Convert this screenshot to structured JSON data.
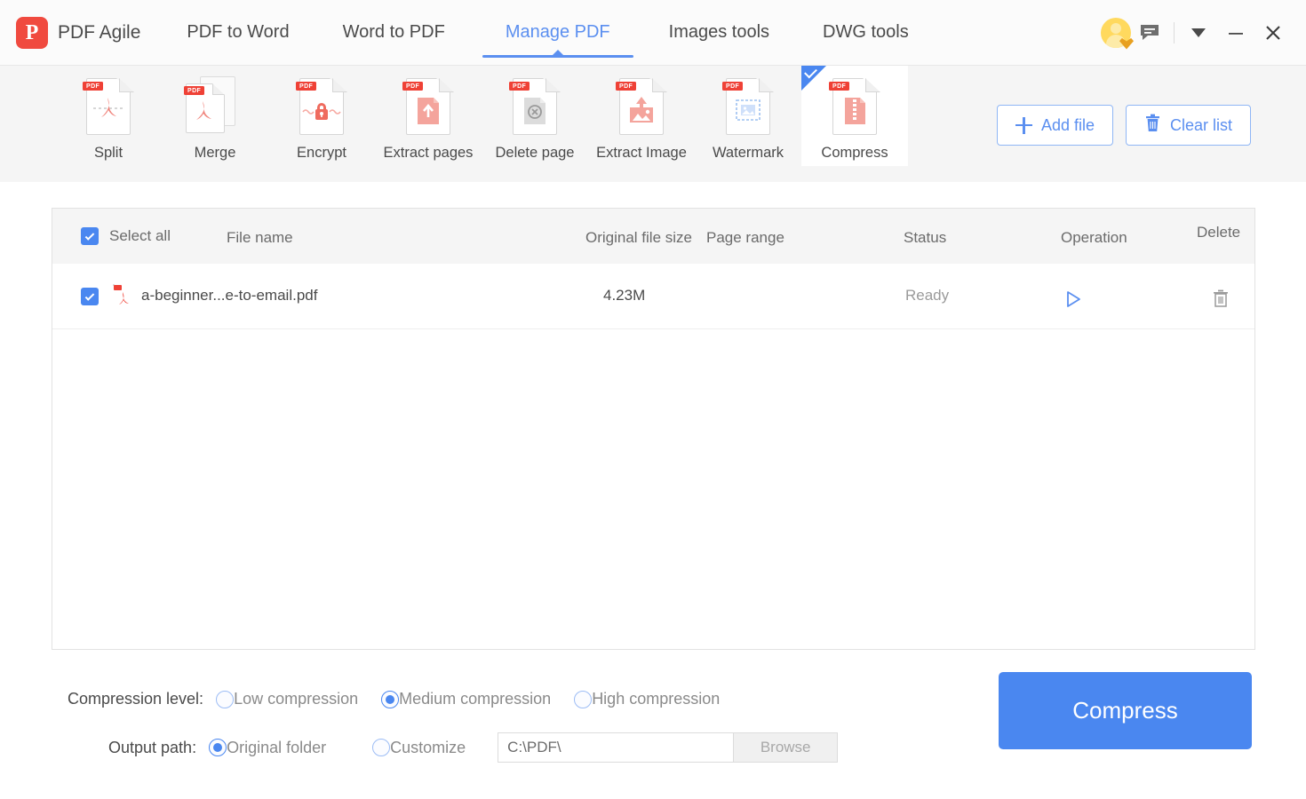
{
  "app": {
    "brand_letter": "P",
    "brand_name": "PDF Agile",
    "brand_color": "#f04a3f",
    "accent_color": "#4a87f0"
  },
  "nav": {
    "items": [
      {
        "label": "PDF to Word",
        "active": false
      },
      {
        "label": "Word to PDF",
        "active": false
      },
      {
        "label": "Manage PDF",
        "active": true
      },
      {
        "label": "Images tools",
        "active": false
      },
      {
        "label": "DWG tools",
        "active": false
      }
    ]
  },
  "window_controls": {
    "avatar": "user-avatar-vip",
    "feedback": "message-icon",
    "dropdown": "chevron-down-icon",
    "minimize": "minimize-icon",
    "close": "close-icon"
  },
  "toolbar": {
    "tools": [
      {
        "label": "Split",
        "icon": "pdf-split-icon",
        "selected": false
      },
      {
        "label": "Merge",
        "icon": "pdf-merge-icon",
        "selected": false
      },
      {
        "label": "Encrypt",
        "icon": "pdf-encrypt-icon",
        "selected": false
      },
      {
        "label": "Extract pages",
        "icon": "pdf-extract-pages-icon",
        "selected": false
      },
      {
        "label": "Delete page",
        "icon": "pdf-delete-page-icon",
        "selected": false
      },
      {
        "label": "Extract Image",
        "icon": "pdf-extract-image-icon",
        "selected": false
      },
      {
        "label": "Watermark",
        "icon": "pdf-watermark-icon",
        "selected": false
      },
      {
        "label": "Compress",
        "icon": "pdf-compress-icon",
        "selected": true
      }
    ],
    "add_file_label": "Add file",
    "clear_list_label": "Clear list"
  },
  "file_list": {
    "select_all_label": "Select all",
    "columns": {
      "file_name": "File name",
      "original_file_size": "Original file size",
      "page_range": "Page range",
      "status": "Status",
      "operation": "Operation",
      "delete": "Delete"
    },
    "rows": [
      {
        "checked": true,
        "file_name": "a-beginner...e-to-email.pdf",
        "original_file_size": "4.23M",
        "page_range": "",
        "status": "Ready"
      }
    ]
  },
  "settings": {
    "compression_level_label": "Compression level:",
    "compression_options": [
      {
        "label": "Low compression",
        "selected": false
      },
      {
        "label": "Medium compression",
        "selected": true
      },
      {
        "label": "High compression",
        "selected": false
      }
    ],
    "output_path_label": "Output path:",
    "output_options": [
      {
        "label": "Original folder",
        "selected": true
      },
      {
        "label": "Customize",
        "selected": false
      }
    ],
    "path_value": "C:\\PDF\\",
    "browse_label": "Browse"
  },
  "primary_action": {
    "label": "Compress"
  }
}
